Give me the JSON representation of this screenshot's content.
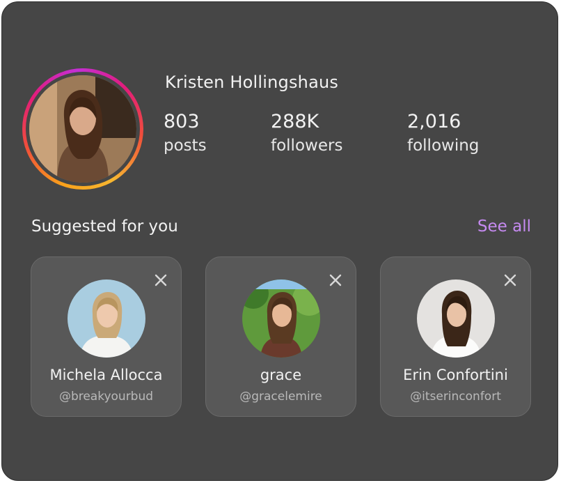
{
  "profile": {
    "name": "Kristen Hollingshaus",
    "stats": [
      {
        "value": "803",
        "label": "posts"
      },
      {
        "value": "288K",
        "label": "followers"
      },
      {
        "value": "2,016",
        "label": "following"
      }
    ]
  },
  "suggestions": {
    "heading": "Suggested for you",
    "see_all_label": "See all",
    "close_icon": "close-icon",
    "items": [
      {
        "name": "Michela Allocca",
        "handle": "@breakyourbud"
      },
      {
        "name": "grace",
        "handle": "@gracelemire"
      },
      {
        "name": "Erin Confortini",
        "handle": "@itserinconfort"
      }
    ]
  },
  "colors": {
    "card_bg": "#464646",
    "tile_bg": "#585858",
    "accent": "#c58af0",
    "story_ring": [
      "#f9a11b",
      "#f04f3a",
      "#e21c7a",
      "#c42fd6"
    ]
  }
}
